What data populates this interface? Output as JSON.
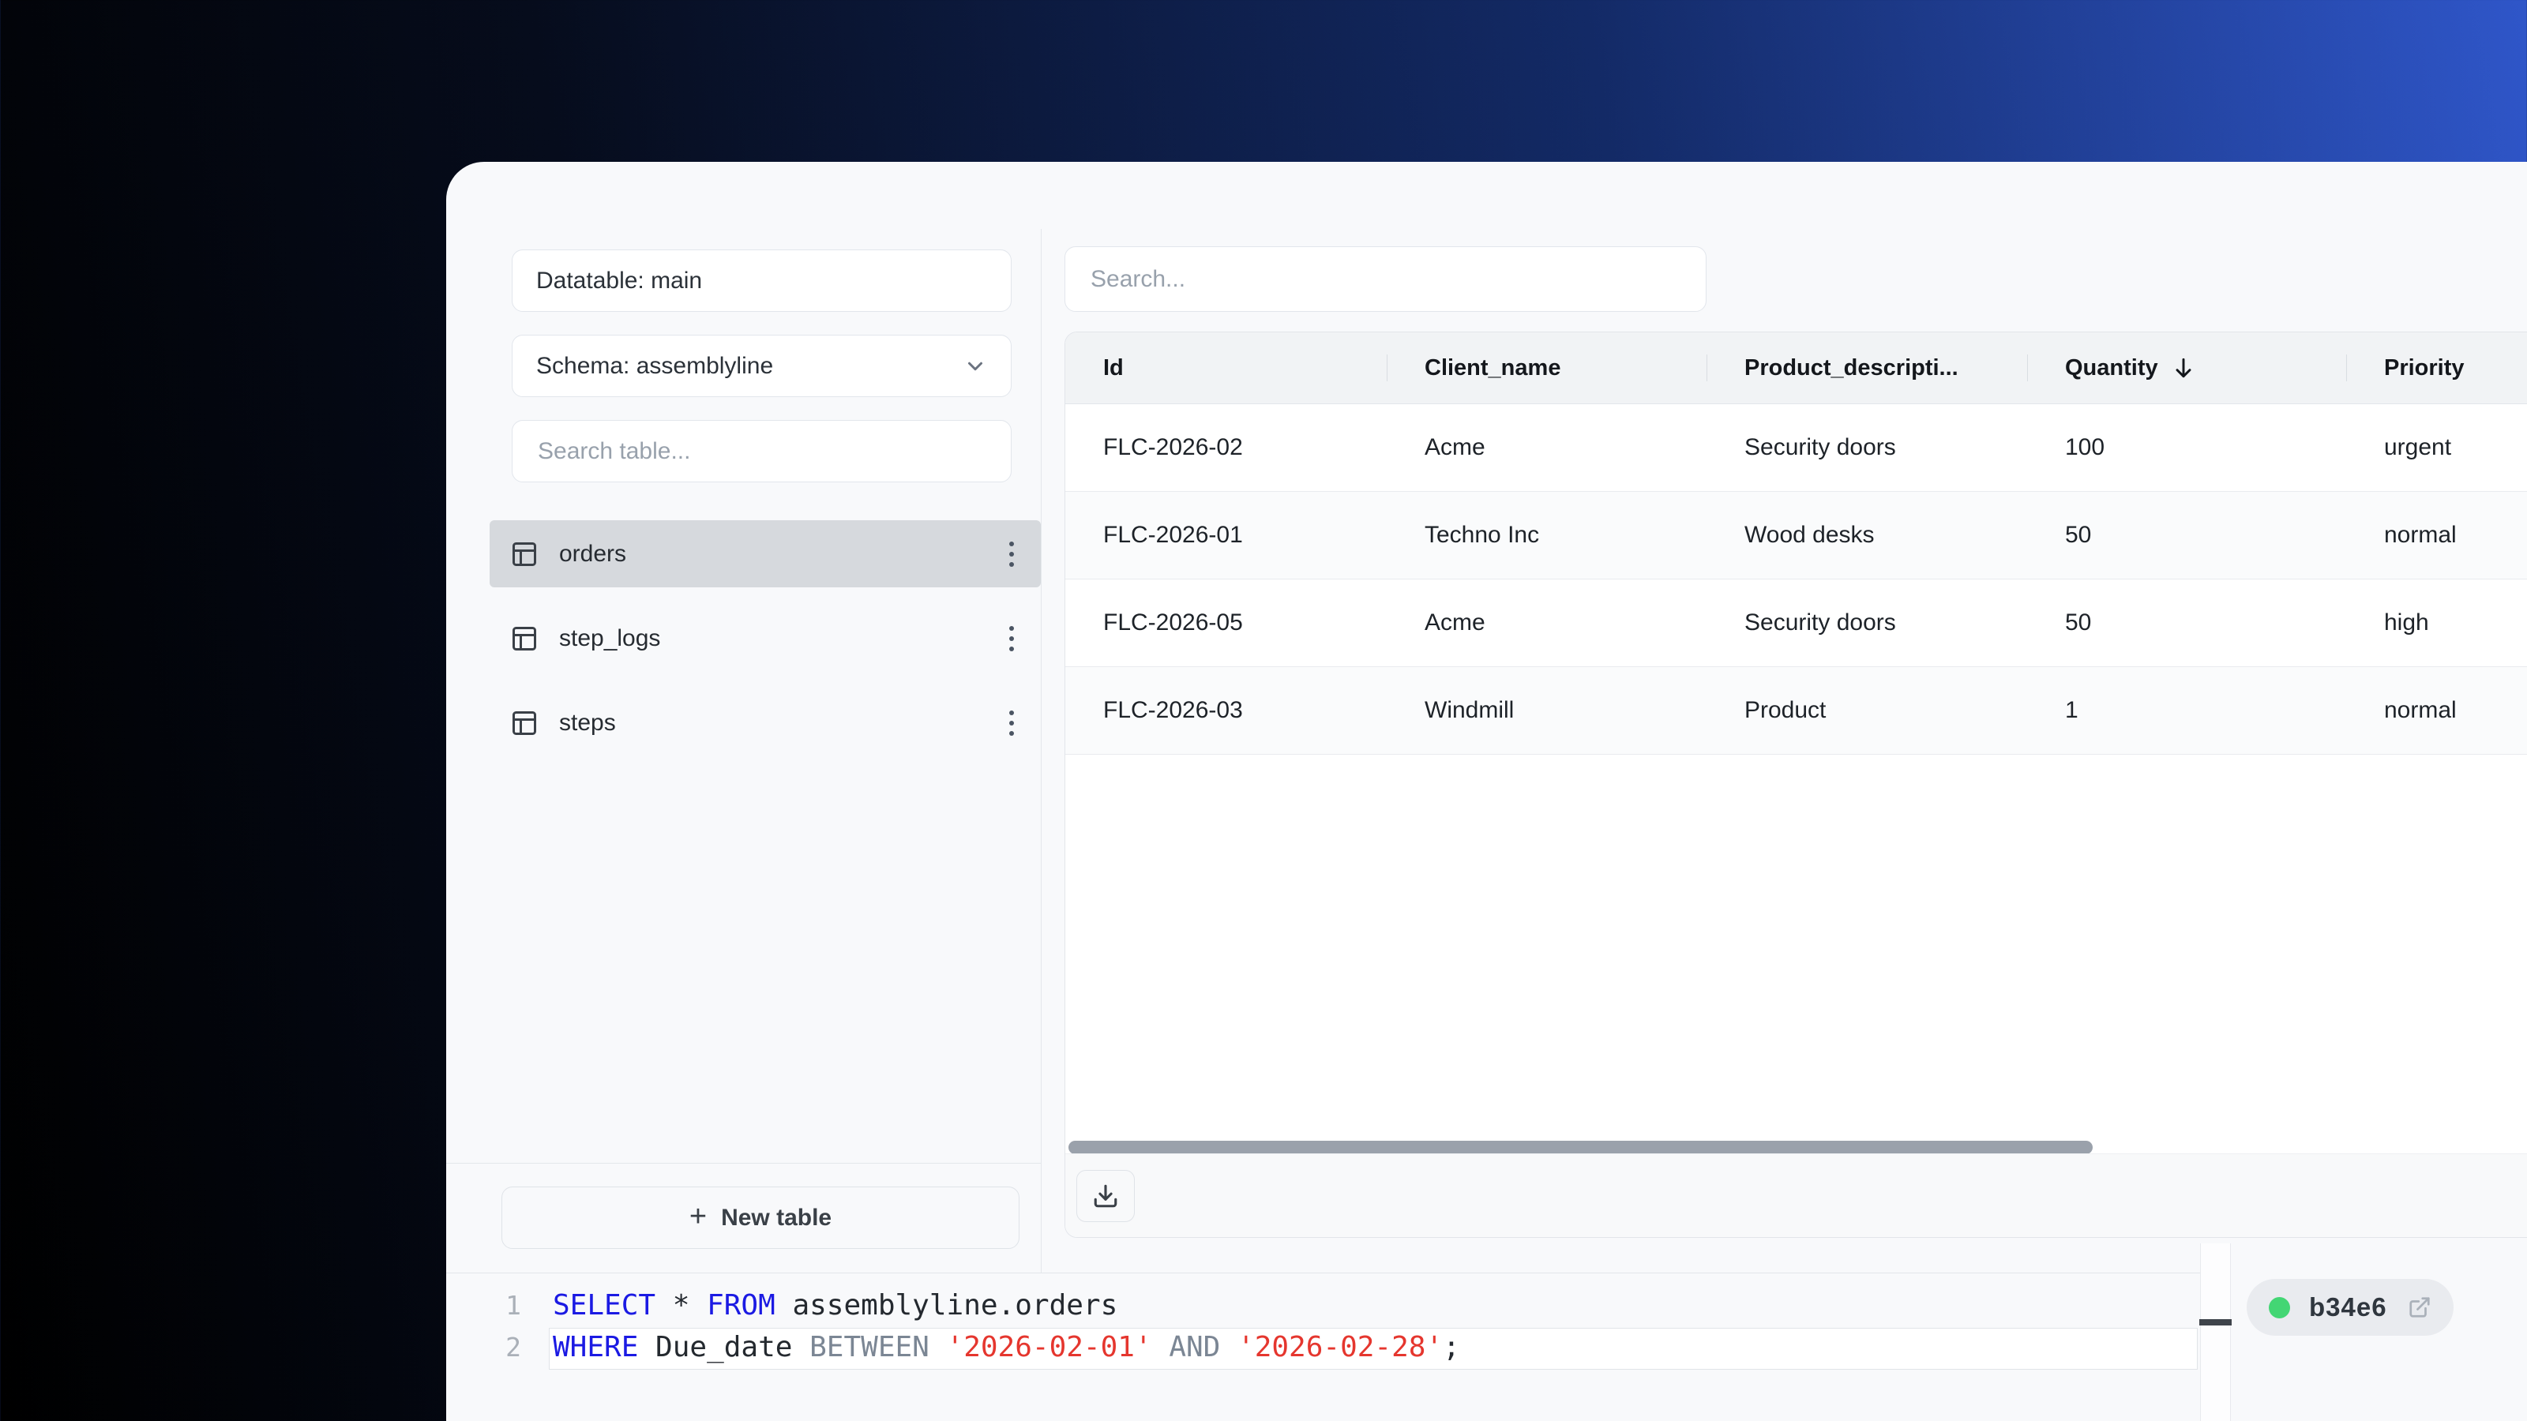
{
  "colors": {
    "bg-grad-left": "#000000",
    "bg-grad-right": "#2f56c9",
    "panel-bg": "#f8f9fb",
    "selected-bg": "#d6d9dd",
    "dot-green": "#43d674",
    "syn-kw": "#1b1ae3",
    "syn-plain": "#24292f",
    "syn-op": "#7b8694",
    "syn-str": "#e5362e"
  },
  "sidebar": {
    "datatable_label": "Datatable: main",
    "schema_label": "Schema: assemblyline",
    "search_placeholder": "Search table...",
    "tables": [
      {
        "name": "orders",
        "selected": true
      },
      {
        "name": "step_logs",
        "selected": false
      },
      {
        "name": "steps",
        "selected": false
      }
    ],
    "new_table_plus": "+",
    "new_table_label": "New table"
  },
  "main": {
    "search_placeholder": "Search...",
    "table": {
      "columns": [
        {
          "label": "Id",
          "sorted": false
        },
        {
          "label": "Client_name",
          "sorted": false
        },
        {
          "label": "Product_descripti...",
          "sorted": false
        },
        {
          "label": "Quantity",
          "sorted": "desc"
        },
        {
          "label": "Priority",
          "sorted": false
        }
      ],
      "rows": [
        [
          "FLC-2026-02",
          "Acme",
          "Security doors",
          "100",
          "urgent"
        ],
        [
          "FLC-2026-01",
          "Techno Inc",
          "Wood desks",
          "50",
          "normal"
        ],
        [
          "FLC-2026-05",
          "Acme",
          "Security doors",
          "50",
          "high"
        ],
        [
          "FLC-2026-03",
          "Windmill",
          "Product",
          "1",
          "normal"
        ]
      ]
    }
  },
  "editor": {
    "lines": [
      {
        "number": "1",
        "current": false,
        "tokens": [
          [
            "SELECT",
            "kw"
          ],
          [
            " * ",
            "pl"
          ],
          [
            "FROM",
            "kw"
          ],
          [
            " assemblyline.orders",
            "pl"
          ]
        ]
      },
      {
        "number": "2",
        "current": true,
        "tokens": [
          [
            "WHERE",
            "kw"
          ],
          [
            " Due_date ",
            "pl"
          ],
          [
            "BETWEEN",
            "op"
          ],
          [
            " ",
            "pl"
          ],
          [
            "'2026-02-01'",
            "str"
          ],
          [
            " ",
            "pl"
          ],
          [
            "AND",
            "op"
          ],
          [
            " ",
            "pl"
          ],
          [
            "'2026-02-28'",
            "str"
          ],
          [
            ";",
            "pl"
          ]
        ]
      }
    ]
  },
  "status": {
    "badge_text": "b34e6"
  }
}
